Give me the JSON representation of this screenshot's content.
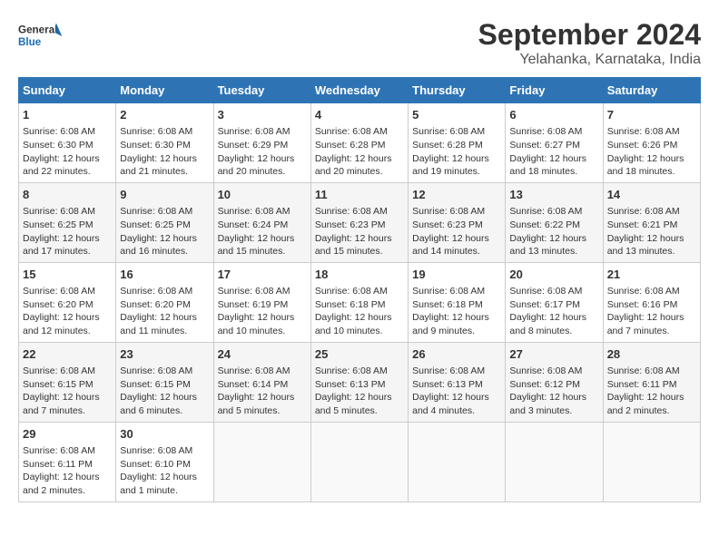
{
  "logo": {
    "line1": "General",
    "line2": "Blue"
  },
  "title": "September 2024",
  "subtitle": "Yelahanka, Karnataka, India",
  "days_of_week": [
    "Sunday",
    "Monday",
    "Tuesday",
    "Wednesday",
    "Thursday",
    "Friday",
    "Saturday"
  ],
  "weeks": [
    [
      {
        "day": "1",
        "sunrise": "6:08 AM",
        "sunset": "6:30 PM",
        "daylight": "12 hours and 22 minutes."
      },
      {
        "day": "2",
        "sunrise": "6:08 AM",
        "sunset": "6:30 PM",
        "daylight": "12 hours and 21 minutes."
      },
      {
        "day": "3",
        "sunrise": "6:08 AM",
        "sunset": "6:29 PM",
        "daylight": "12 hours and 20 minutes."
      },
      {
        "day": "4",
        "sunrise": "6:08 AM",
        "sunset": "6:28 PM",
        "daylight": "12 hours and 20 minutes."
      },
      {
        "day": "5",
        "sunrise": "6:08 AM",
        "sunset": "6:28 PM",
        "daylight": "12 hours and 19 minutes."
      },
      {
        "day": "6",
        "sunrise": "6:08 AM",
        "sunset": "6:27 PM",
        "daylight": "12 hours and 18 minutes."
      },
      {
        "day": "7",
        "sunrise": "6:08 AM",
        "sunset": "6:26 PM",
        "daylight": "12 hours and 18 minutes."
      }
    ],
    [
      {
        "day": "8",
        "sunrise": "6:08 AM",
        "sunset": "6:25 PM",
        "daylight": "12 hours and 17 minutes."
      },
      {
        "day": "9",
        "sunrise": "6:08 AM",
        "sunset": "6:25 PM",
        "daylight": "12 hours and 16 minutes."
      },
      {
        "day": "10",
        "sunrise": "6:08 AM",
        "sunset": "6:24 PM",
        "daylight": "12 hours and 15 minutes."
      },
      {
        "day": "11",
        "sunrise": "6:08 AM",
        "sunset": "6:23 PM",
        "daylight": "12 hours and 15 minutes."
      },
      {
        "day": "12",
        "sunrise": "6:08 AM",
        "sunset": "6:23 PM",
        "daylight": "12 hours and 14 minutes."
      },
      {
        "day": "13",
        "sunrise": "6:08 AM",
        "sunset": "6:22 PM",
        "daylight": "12 hours and 13 minutes."
      },
      {
        "day": "14",
        "sunrise": "6:08 AM",
        "sunset": "6:21 PM",
        "daylight": "12 hours and 13 minutes."
      }
    ],
    [
      {
        "day": "15",
        "sunrise": "6:08 AM",
        "sunset": "6:20 PM",
        "daylight": "12 hours and 12 minutes."
      },
      {
        "day": "16",
        "sunrise": "6:08 AM",
        "sunset": "6:20 PM",
        "daylight": "12 hours and 11 minutes."
      },
      {
        "day": "17",
        "sunrise": "6:08 AM",
        "sunset": "6:19 PM",
        "daylight": "12 hours and 10 minutes."
      },
      {
        "day": "18",
        "sunrise": "6:08 AM",
        "sunset": "6:18 PM",
        "daylight": "12 hours and 10 minutes."
      },
      {
        "day": "19",
        "sunrise": "6:08 AM",
        "sunset": "6:18 PM",
        "daylight": "12 hours and 9 minutes."
      },
      {
        "day": "20",
        "sunrise": "6:08 AM",
        "sunset": "6:17 PM",
        "daylight": "12 hours and 8 minutes."
      },
      {
        "day": "21",
        "sunrise": "6:08 AM",
        "sunset": "6:16 PM",
        "daylight": "12 hours and 7 minutes."
      }
    ],
    [
      {
        "day": "22",
        "sunrise": "6:08 AM",
        "sunset": "6:15 PM",
        "daylight": "12 hours and 7 minutes."
      },
      {
        "day": "23",
        "sunrise": "6:08 AM",
        "sunset": "6:15 PM",
        "daylight": "12 hours and 6 minutes."
      },
      {
        "day": "24",
        "sunrise": "6:08 AM",
        "sunset": "6:14 PM",
        "daylight": "12 hours and 5 minutes."
      },
      {
        "day": "25",
        "sunrise": "6:08 AM",
        "sunset": "6:13 PM",
        "daylight": "12 hours and 5 minutes."
      },
      {
        "day": "26",
        "sunrise": "6:08 AM",
        "sunset": "6:13 PM",
        "daylight": "12 hours and 4 minutes."
      },
      {
        "day": "27",
        "sunrise": "6:08 AM",
        "sunset": "6:12 PM",
        "daylight": "12 hours and 3 minutes."
      },
      {
        "day": "28",
        "sunrise": "6:08 AM",
        "sunset": "6:11 PM",
        "daylight": "12 hours and 2 minutes."
      }
    ],
    [
      {
        "day": "29",
        "sunrise": "6:08 AM",
        "sunset": "6:11 PM",
        "daylight": "12 hours and 2 minutes."
      },
      {
        "day": "30",
        "sunrise": "6:08 AM",
        "sunset": "6:10 PM",
        "daylight": "12 hours and 1 minute."
      },
      {
        "day": "",
        "sunrise": "",
        "sunset": "",
        "daylight": ""
      },
      {
        "day": "",
        "sunrise": "",
        "sunset": "",
        "daylight": ""
      },
      {
        "day": "",
        "sunrise": "",
        "sunset": "",
        "daylight": ""
      },
      {
        "day": "",
        "sunrise": "",
        "sunset": "",
        "daylight": ""
      },
      {
        "day": "",
        "sunrise": "",
        "sunset": "",
        "daylight": ""
      }
    ]
  ],
  "labels": {
    "sunrise": "Sunrise:",
    "sunset": "Sunset:",
    "daylight": "Daylight:"
  }
}
